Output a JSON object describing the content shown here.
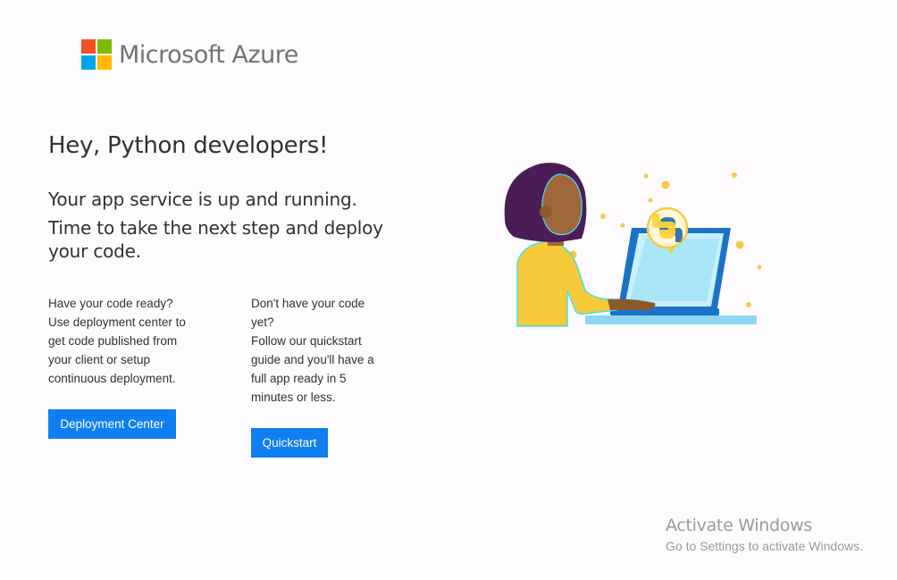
{
  "logo": {
    "text": "Microsoft Azure",
    "colors": [
      "#f25022",
      "#7fba00",
      "#00a4ef",
      "#ffb900"
    ]
  },
  "headline": "Hey, Python developers!",
  "subtitle": {
    "line1": "Your app service is up and running.",
    "line2": "Time to take the next step and deploy your code."
  },
  "left_column": {
    "text": "Have your code ready?\nUse deployment center to get code published from your client or setup continuous deployment.",
    "button_label": "Deployment Center"
  },
  "right_column": {
    "text": "Don't have your code yet?\nFollow our quickstart guide and you'll have a full app ready in 5 minutes or less.",
    "button_label": "Quickstart"
  },
  "illustration": {
    "icon": "developer-laptop-python-illustration"
  },
  "watermark": {
    "title": "Activate Windows",
    "subtitle": "Go to Settings to activate Windows."
  },
  "colors": {
    "accent": "#0f7fef",
    "background": "#fdfbfd"
  }
}
